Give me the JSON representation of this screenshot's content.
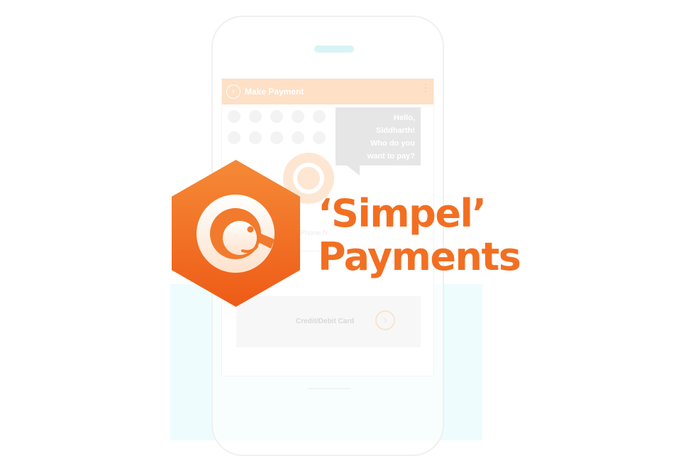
{
  "app": {
    "header_icon": "chevron-right-icon",
    "header_title": "Make Payment",
    "menu_icon": "more-vertical-icon"
  },
  "chat": {
    "greeting": "Hello,\nSiddharth!\nWho do you\nwant to pay?"
  },
  "form": {
    "phone_label": "Phone N"
  },
  "payment_option": {
    "label": "Credit/Debit Card",
    "go_icon": "chevron-right-icon"
  },
  "logo": {
    "line1": "‘Simpel’",
    "line2": "Payments",
    "colors": {
      "brand_orange": "#f26f22",
      "hex_top": "#f58a37",
      "hex_bottom": "#ee5b16",
      "header_tint": "#fde0c6"
    }
  }
}
